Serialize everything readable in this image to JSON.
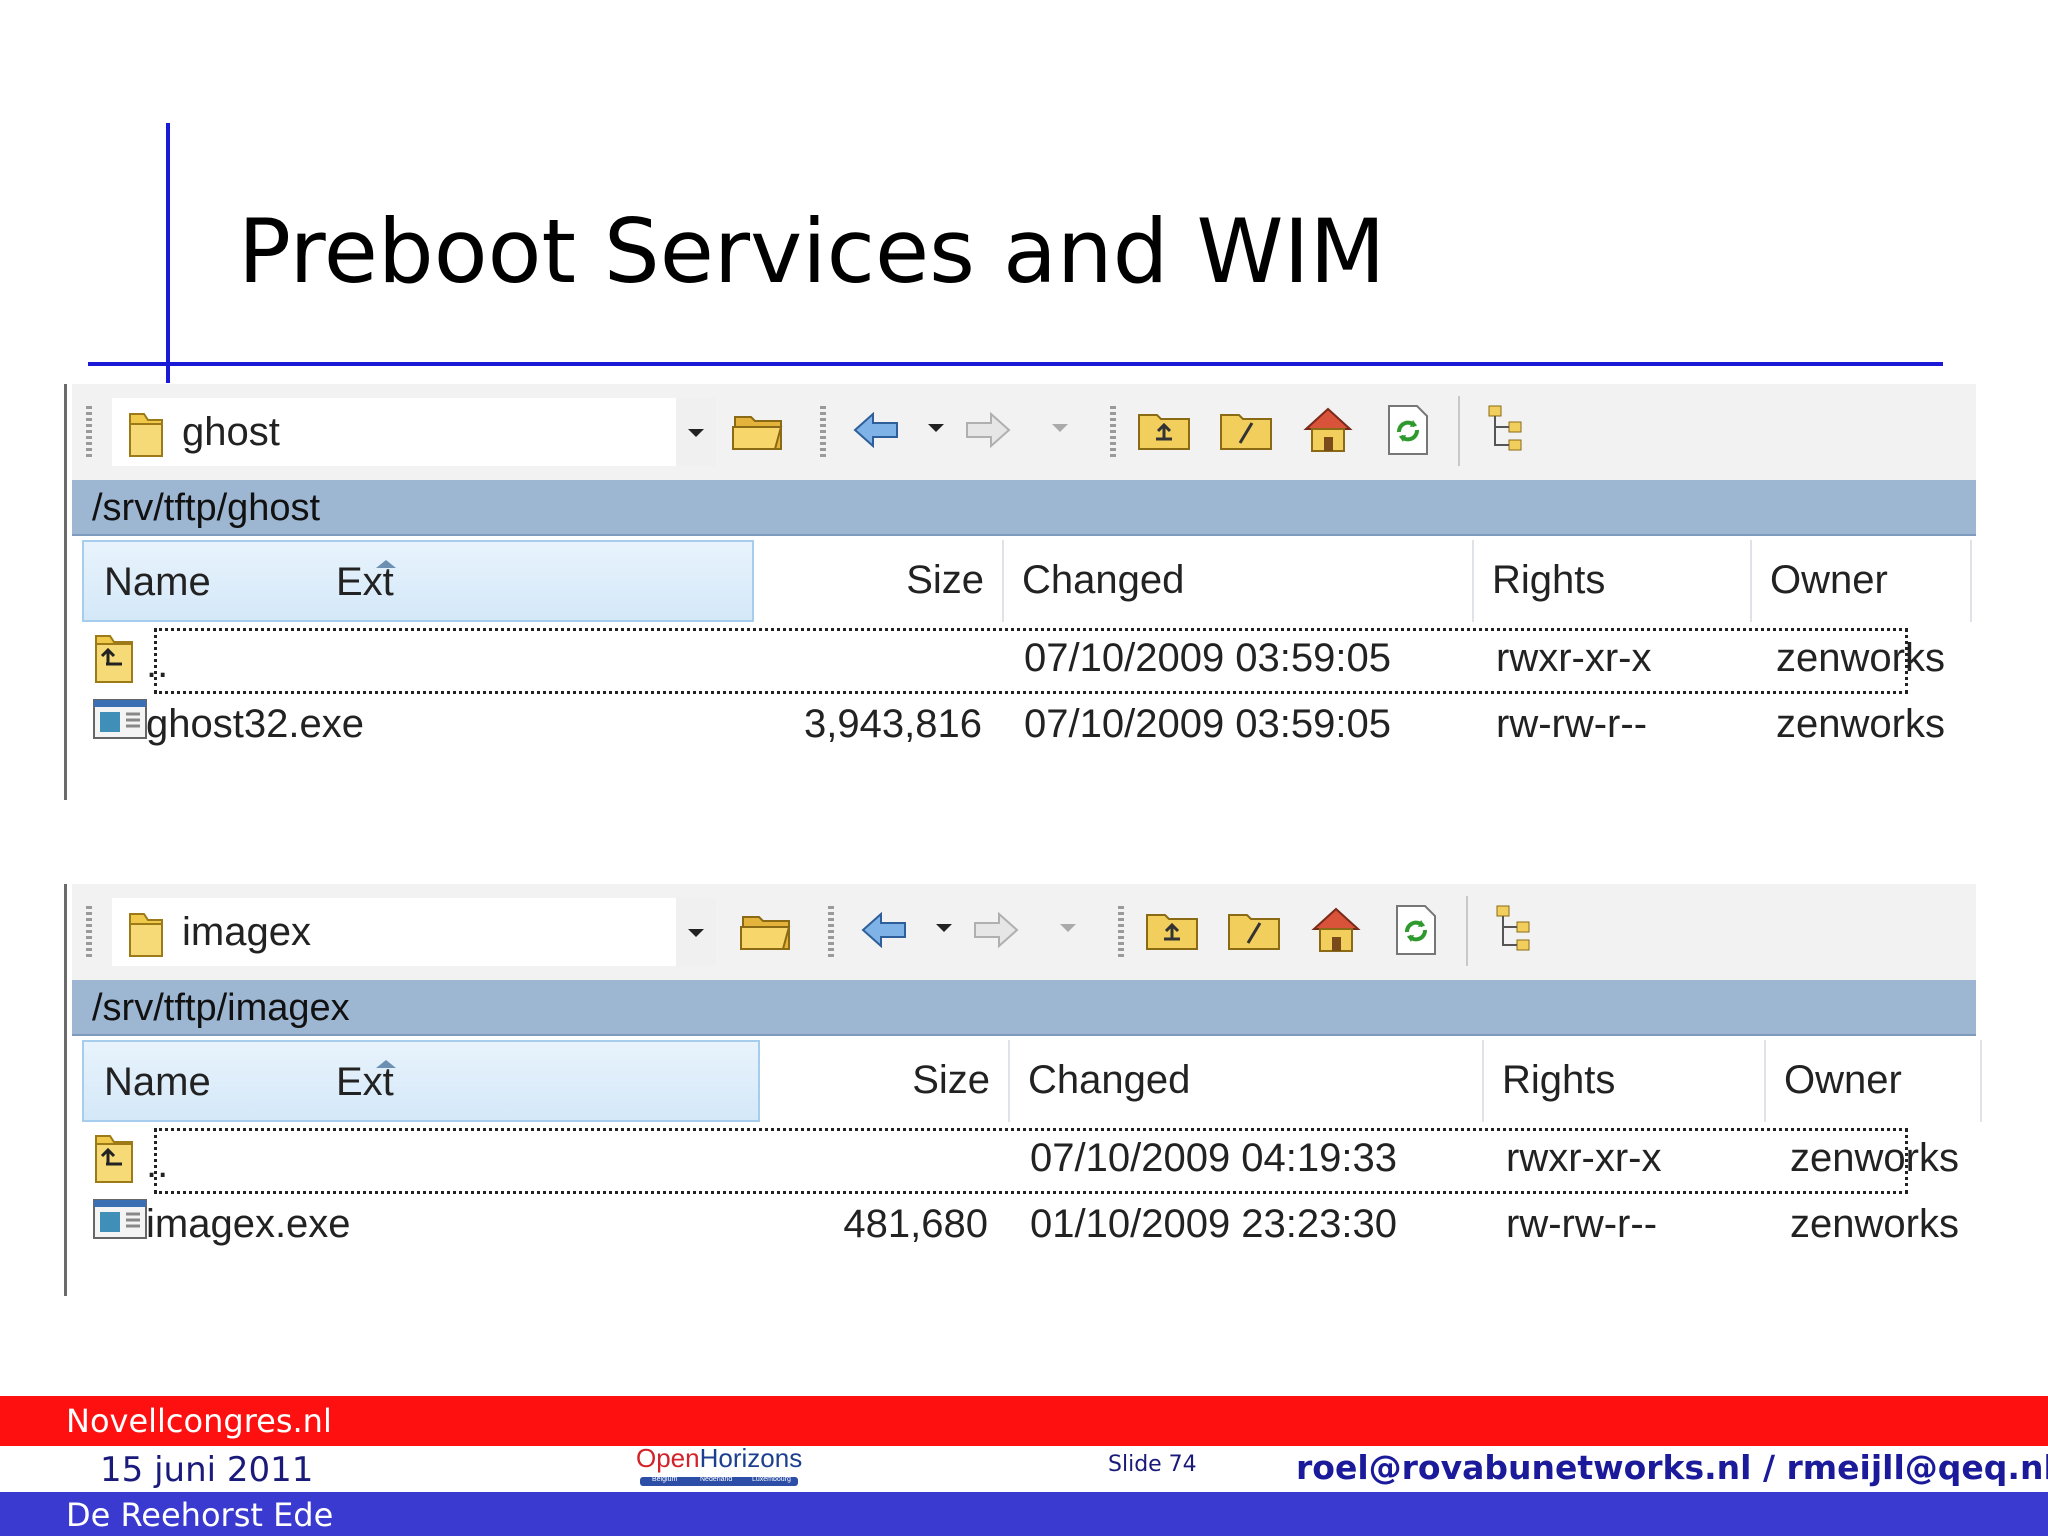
{
  "slide": {
    "title": "Preboot Services and WIM"
  },
  "panels": [
    {
      "folder": "ghost",
      "path": "/srv/tftp/ghost",
      "columns": {
        "name": "Name",
        "ext": "Ext",
        "size": "Size",
        "changed": "Changed",
        "rights": "Rights",
        "owner": "Owner"
      },
      "rows": [
        {
          "name": "..",
          "size": "",
          "changed": "07/10/2009 03:59:05",
          "rights": "rwxr-xr-x",
          "owner": "zenworks",
          "icon": "parent-folder-icon"
        },
        {
          "name": "ghost32.exe",
          "size": "3,943,816",
          "changed": "07/10/2009 03:59:05",
          "rights": "rw-rw-r--",
          "owner": "zenworks",
          "icon": "exe-file-icon"
        }
      ]
    },
    {
      "folder": "imagex",
      "path": "/srv/tftp/imagex",
      "columns": {
        "name": "Name",
        "ext": "Ext",
        "size": "Size",
        "changed": "Changed",
        "rights": "Rights",
        "owner": "Owner"
      },
      "rows": [
        {
          "name": "..",
          "size": "",
          "changed": "07/10/2009 04:19:33",
          "rights": "rwxr-xr-x",
          "owner": "zenworks",
          "icon": "parent-folder-icon"
        },
        {
          "name": "imagex.exe",
          "size": "481,680",
          "changed": "01/10/2009 23:23:30",
          "rights": "rw-rw-r--",
          "owner": "zenworks",
          "icon": "exe-file-icon"
        }
      ]
    }
  ],
  "toolbar_icons": [
    "open-folder-icon",
    "back-arrow-icon",
    "forward-arrow-icon",
    "parent-directory-icon",
    "root-directory-icon",
    "home-directory-icon",
    "refresh-icon",
    "tree-view-icon"
  ],
  "footer": {
    "site": "Novellcongres.nl",
    "date": "15 juni 2011",
    "venue": "De Reehorst Ede",
    "slide": "Slide 74",
    "email": "roel@rovabunetworks.nl  / rmeijll@qeq.nl",
    "logo": {
      "open": "Open",
      "horizons": "Horizons",
      "countries": [
        "Belgium",
        "Nederland",
        "Luxembourg"
      ]
    }
  },
  "colors": {
    "accent_blue": "#1a1ad6",
    "footer_red": "#ff1010",
    "footer_blue": "#3a3ad0",
    "pathbar": "#9db6d2"
  }
}
